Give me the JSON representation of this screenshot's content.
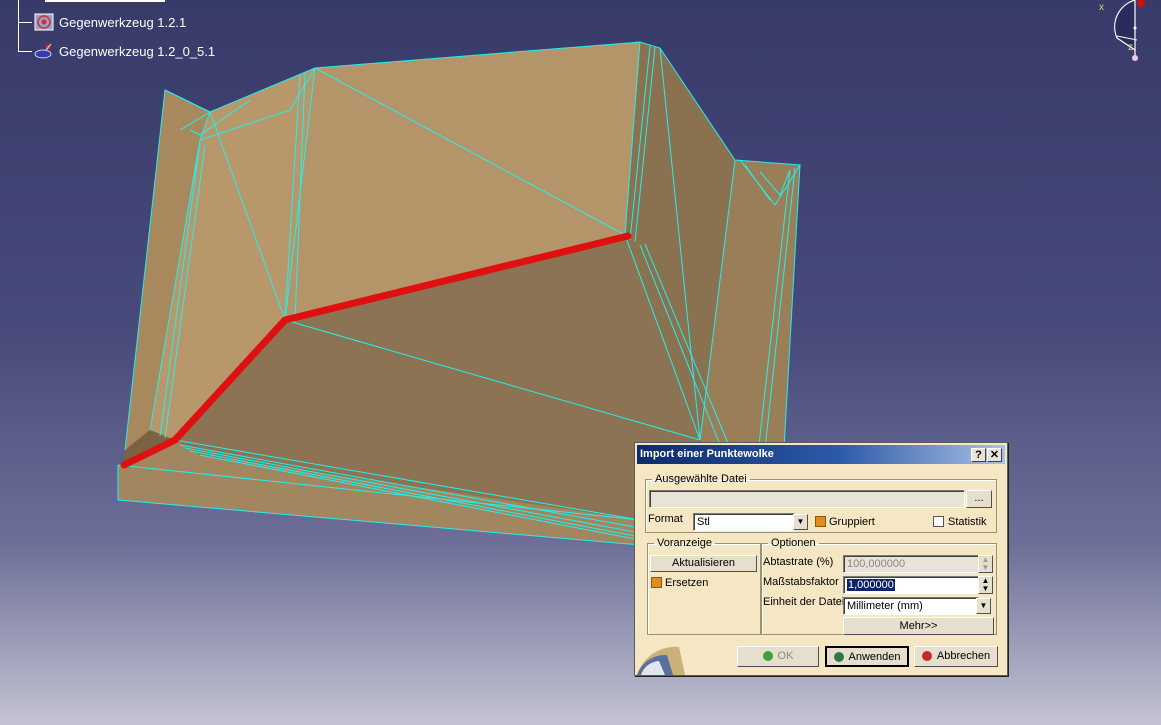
{
  "tree": {
    "items": [
      {
        "label": "Gegenwerkzeug 1.2.1",
        "icon": "target-tool-icon"
      },
      {
        "label": "Gegenwerkzeug 1.2_0_5.1",
        "icon": "point-cloud-icon"
      }
    ]
  },
  "compass": {
    "axis_x": "x",
    "axis_z": "z"
  },
  "dialog": {
    "title": "Import einer Punktewolke",
    "help_label": "?",
    "close_label": "✕",
    "file_group": {
      "legend": "Ausgewählte Datei",
      "path_value": "",
      "browse_label": "...",
      "format_label": "Format",
      "format_value": "Stl",
      "grouped_label": "Gruppiert",
      "grouped_checked": true,
      "stats_label": "Statistik",
      "stats_checked": false
    },
    "preview_group": {
      "legend": "Voranzeige",
      "update_label": "Aktualisieren",
      "replace_label": "Ersetzen",
      "replace_checked": true
    },
    "options_group": {
      "legend": "Optionen",
      "sampling_label": "Abtastrate (%)",
      "sampling_value": "100,000000",
      "scale_label": "Maßstabsfaktor",
      "scale_value": "1,000000",
      "unit_label": "Einheit der Datei",
      "unit_value": "Millimeter (mm)",
      "more_label": "Mehr>>"
    },
    "buttons": {
      "ok_label": "OK",
      "apply_label": "Anwenden",
      "cancel_label": "Abbrechen"
    }
  },
  "colors": {
    "background_top": "#383b6a",
    "surface": "#b8986a",
    "mesh_edges": "#22f0ee",
    "highlight_curve": "#e01010",
    "dialog_bg": "#f5e6c4",
    "title_bar": "#0c2b6b"
  }
}
